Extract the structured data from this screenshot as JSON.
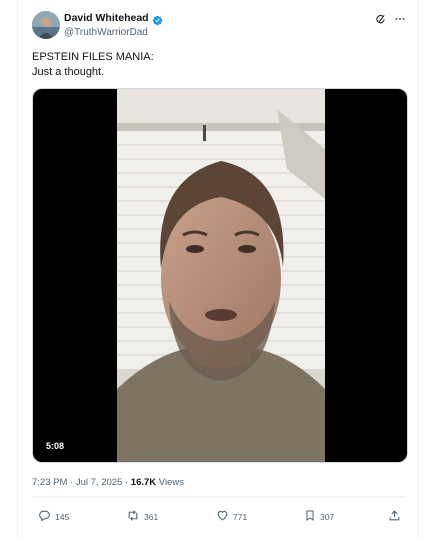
{
  "author": {
    "display_name": "David Whitehead",
    "handle": "@TruthWarriorDad",
    "verified_color": "#1d9bf0"
  },
  "header_icons": [
    "grok-icon",
    "more-icon"
  ],
  "tweet": {
    "line1": "EPSTEIN FILES MANIA:",
    "line2": "Just a thought."
  },
  "video": {
    "duration": "5:08"
  },
  "meta": {
    "time": "7:23 PM",
    "separator1": " · ",
    "date": "Jul 7, 2025",
    "separator2": " · ",
    "views_count": "16.7K",
    "views_label": " Views"
  },
  "actions": {
    "replies": "145",
    "reposts": "361",
    "likes": "771",
    "bookmarks": "307"
  }
}
